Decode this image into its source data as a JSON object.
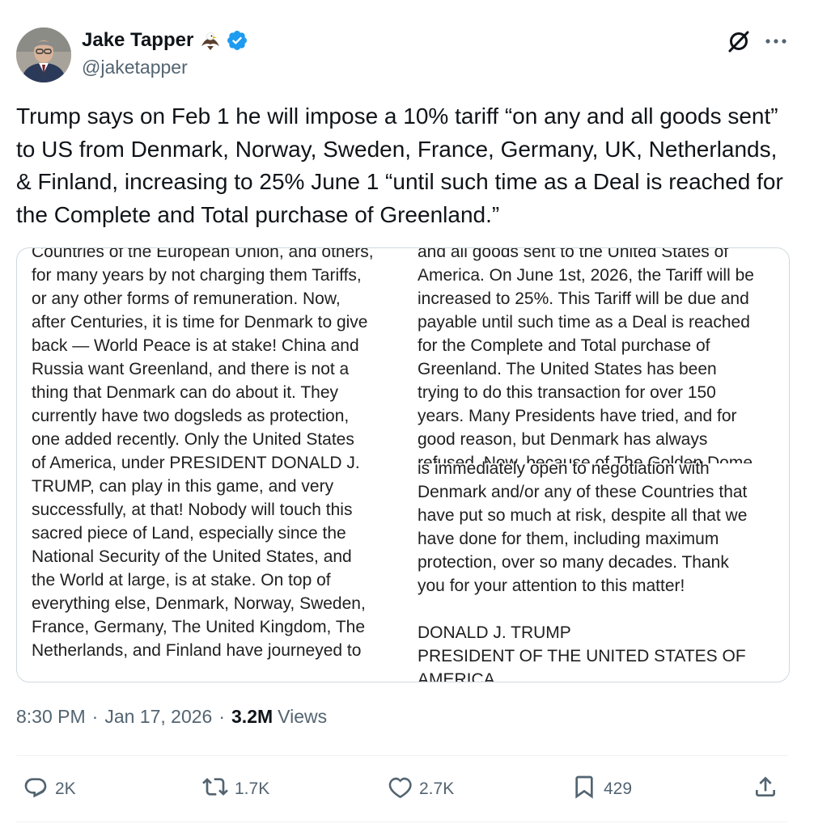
{
  "author": {
    "name": "Jake Tapper",
    "handle": "@jaketapper",
    "emoji_icon": "eagle-icon",
    "verified_color": "#1d9bf0"
  },
  "tweet": {
    "text": "Trump says on Feb 1 he will impose a  10% tariff “on any and all goods sent” to US from Denmark, Norway, Sweden, France, Germany, UK, Netherlands, & Finland, increasing to 25% June 1 “until such time as a Deal is reached for the Complete and Total purchase of Greenland.”"
  },
  "media": {
    "left_text": "Countries of the European Union, and others,\nfor many years by not charging them Tariffs,\nor any other forms of remuneration. Now,\nafter Centuries, it is time for Denmark to give\nback — World Peace is at stake! China and\nRussia want Greenland, and there is not a\nthing that Denmark can do about it. They\ncurrently have two dogsleds as protection,\none added recently. Only the United States\nof America, under PRESIDENT DONALD J.\nTRUMP, can play in this game, and very\nsuccessfully, at that! Nobody will touch this\nsacred piece of Land, especially since the\nNational Security of the United States, and\nthe World at large, is at stake. On top of\neverything else, Denmark, Norway, Sweden,\nFrance, Germany, The United Kingdom, The\nNetherlands, and Finland have journeyed to",
    "right_text_top": "and all goods sent to the United States of\nAmerica. On June 1st, 2026, the Tariff will be\nincreased to 25%. This Tariff will be due and\npayable until such time as a Deal is reached\nfor the Complete and Total purchase of\nGreenland. The United States has been\ntrying to do this transaction for over 150\nyears. Many Presidents have tried, and for\ngood reason, but Denmark has always\nrefused. Now, because of The Golden Dome",
    "right_text_bottom": "is immediately open to negotiation with\nDenmark and/or any of these Countries that\nhave put so much at risk, despite all that we\nhave done for them, including maximum\nprotection, over so many decades. Thank\nyou for your attention to this matter!\n\nDONALD J. TRUMP\nPRESIDENT OF THE UNITED STATES OF\nAMERICA"
  },
  "meta": {
    "time": "8:30 PM",
    "date": "Jan 17, 2026",
    "separator": "·",
    "views_count": "3.2M",
    "views_label": "Views"
  },
  "actions": {
    "replies": "2K",
    "reposts": "1.7K",
    "likes": "2.7K",
    "bookmarks": "429"
  },
  "icons": [
    "grok-icon",
    "more-icon",
    "reply-icon",
    "repost-icon",
    "like-icon",
    "bookmark-icon",
    "share-icon"
  ]
}
